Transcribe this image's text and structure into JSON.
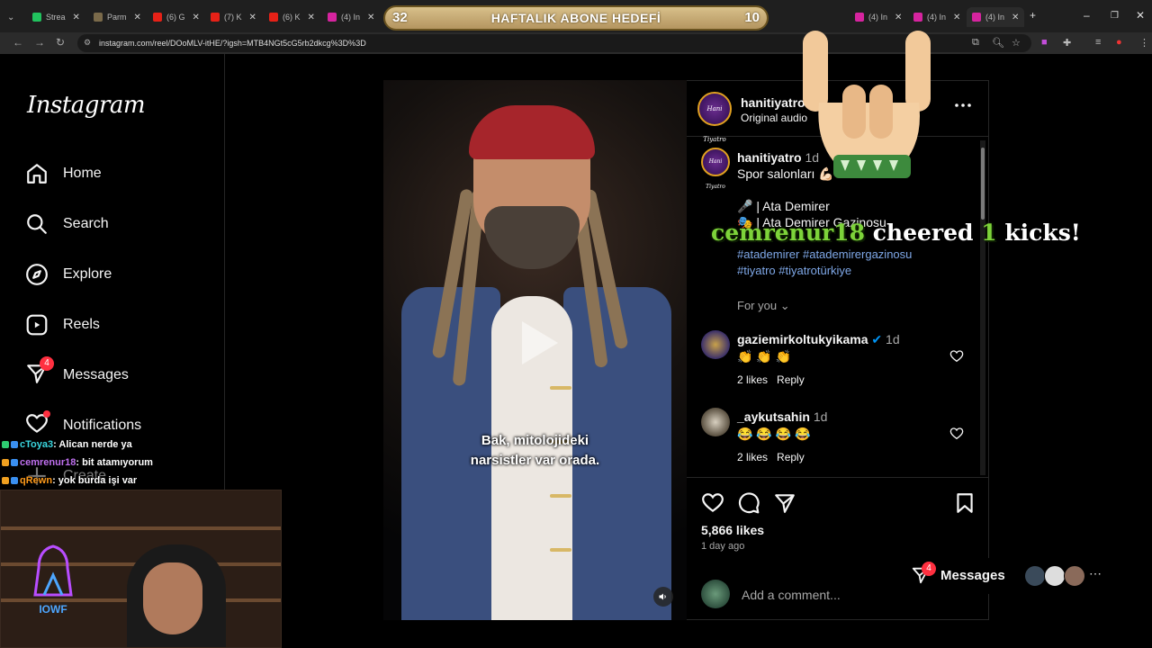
{
  "browser": {
    "tabs": [
      "Strea",
      "Parm",
      "(6) G",
      "(7) K",
      "(6) K",
      "(4) In",
      "(4) In",
      "(4) In",
      "(4) In"
    ],
    "url": "instagram.com/reel/DOoMLV-itHE/?igsh=MTB4NGt5cG5rb2dkcg%3D%3D"
  },
  "goal_overlay": {
    "left_count": "32",
    "title": "HAFTALIK ABONE HEDEFİ",
    "right_count": "10"
  },
  "sidebar": {
    "logo": "Instagram",
    "items": [
      {
        "label": "Home",
        "icon": "home-icon"
      },
      {
        "label": "Search",
        "icon": "search-icon"
      },
      {
        "label": "Explore",
        "icon": "compass-icon"
      },
      {
        "label": "Reels",
        "icon": "reels-icon"
      },
      {
        "label": "Messages",
        "icon": "messenger-icon",
        "badge": "4"
      },
      {
        "label": "Notifications",
        "icon": "heart-icon"
      },
      {
        "label": "Create",
        "icon": "plus-icon"
      }
    ]
  },
  "video": {
    "subtitle_line1": "Bak, mitolojideki",
    "subtitle_line2": "narsistler var orada."
  },
  "post": {
    "username": "hanitiyatro",
    "audio": "Original audio",
    "avatar_text": "Hani Tiyatro",
    "caption": {
      "username": "hanitiyatro",
      "time": "1d",
      "line1": "Spor salonları 💪🏻",
      "line2": "🎤 | Ata Demirer",
      "line3": "🎭 | Ata Demirer Gazinosu",
      "tags_line1": "#atademirer #atademirergazinosu",
      "tags_line2": "#tiyatro #tiyatrotürkiye"
    },
    "for_you": "For you",
    "comments": [
      {
        "username": "gaziemirkoltukyikama",
        "time": "1d",
        "text": "👏 👏 👏",
        "likes": "2 likes",
        "reply": "Reply"
      },
      {
        "username": "_aykutsahin",
        "time": "1d",
        "text": "😂 😂 😂 😂",
        "likes": "2 likes",
        "reply": "Reply"
      }
    ],
    "likes": "5,866 likes",
    "date": "1 day ago",
    "comment_placeholder": "Add a comment..."
  },
  "cheer": {
    "name": "cemrenur18",
    "cheered": "cheered",
    "count": "1",
    "unit": "kicks!"
  },
  "chat": [
    {
      "user": "cToya3",
      "text": ": Alican nerde ya",
      "color": "#3ad7e0"
    },
    {
      "user": "cemrenur18",
      "text": ": bit atamıyorum",
      "color": "#c070f0"
    },
    {
      "user": "qRewn",
      "text": ": yok burda işi var",
      "color": "#ff9a1a"
    }
  ],
  "messages_pill": {
    "label": "Messages",
    "badge": "4"
  },
  "webcam": {
    "neon_text": "IOWF"
  }
}
